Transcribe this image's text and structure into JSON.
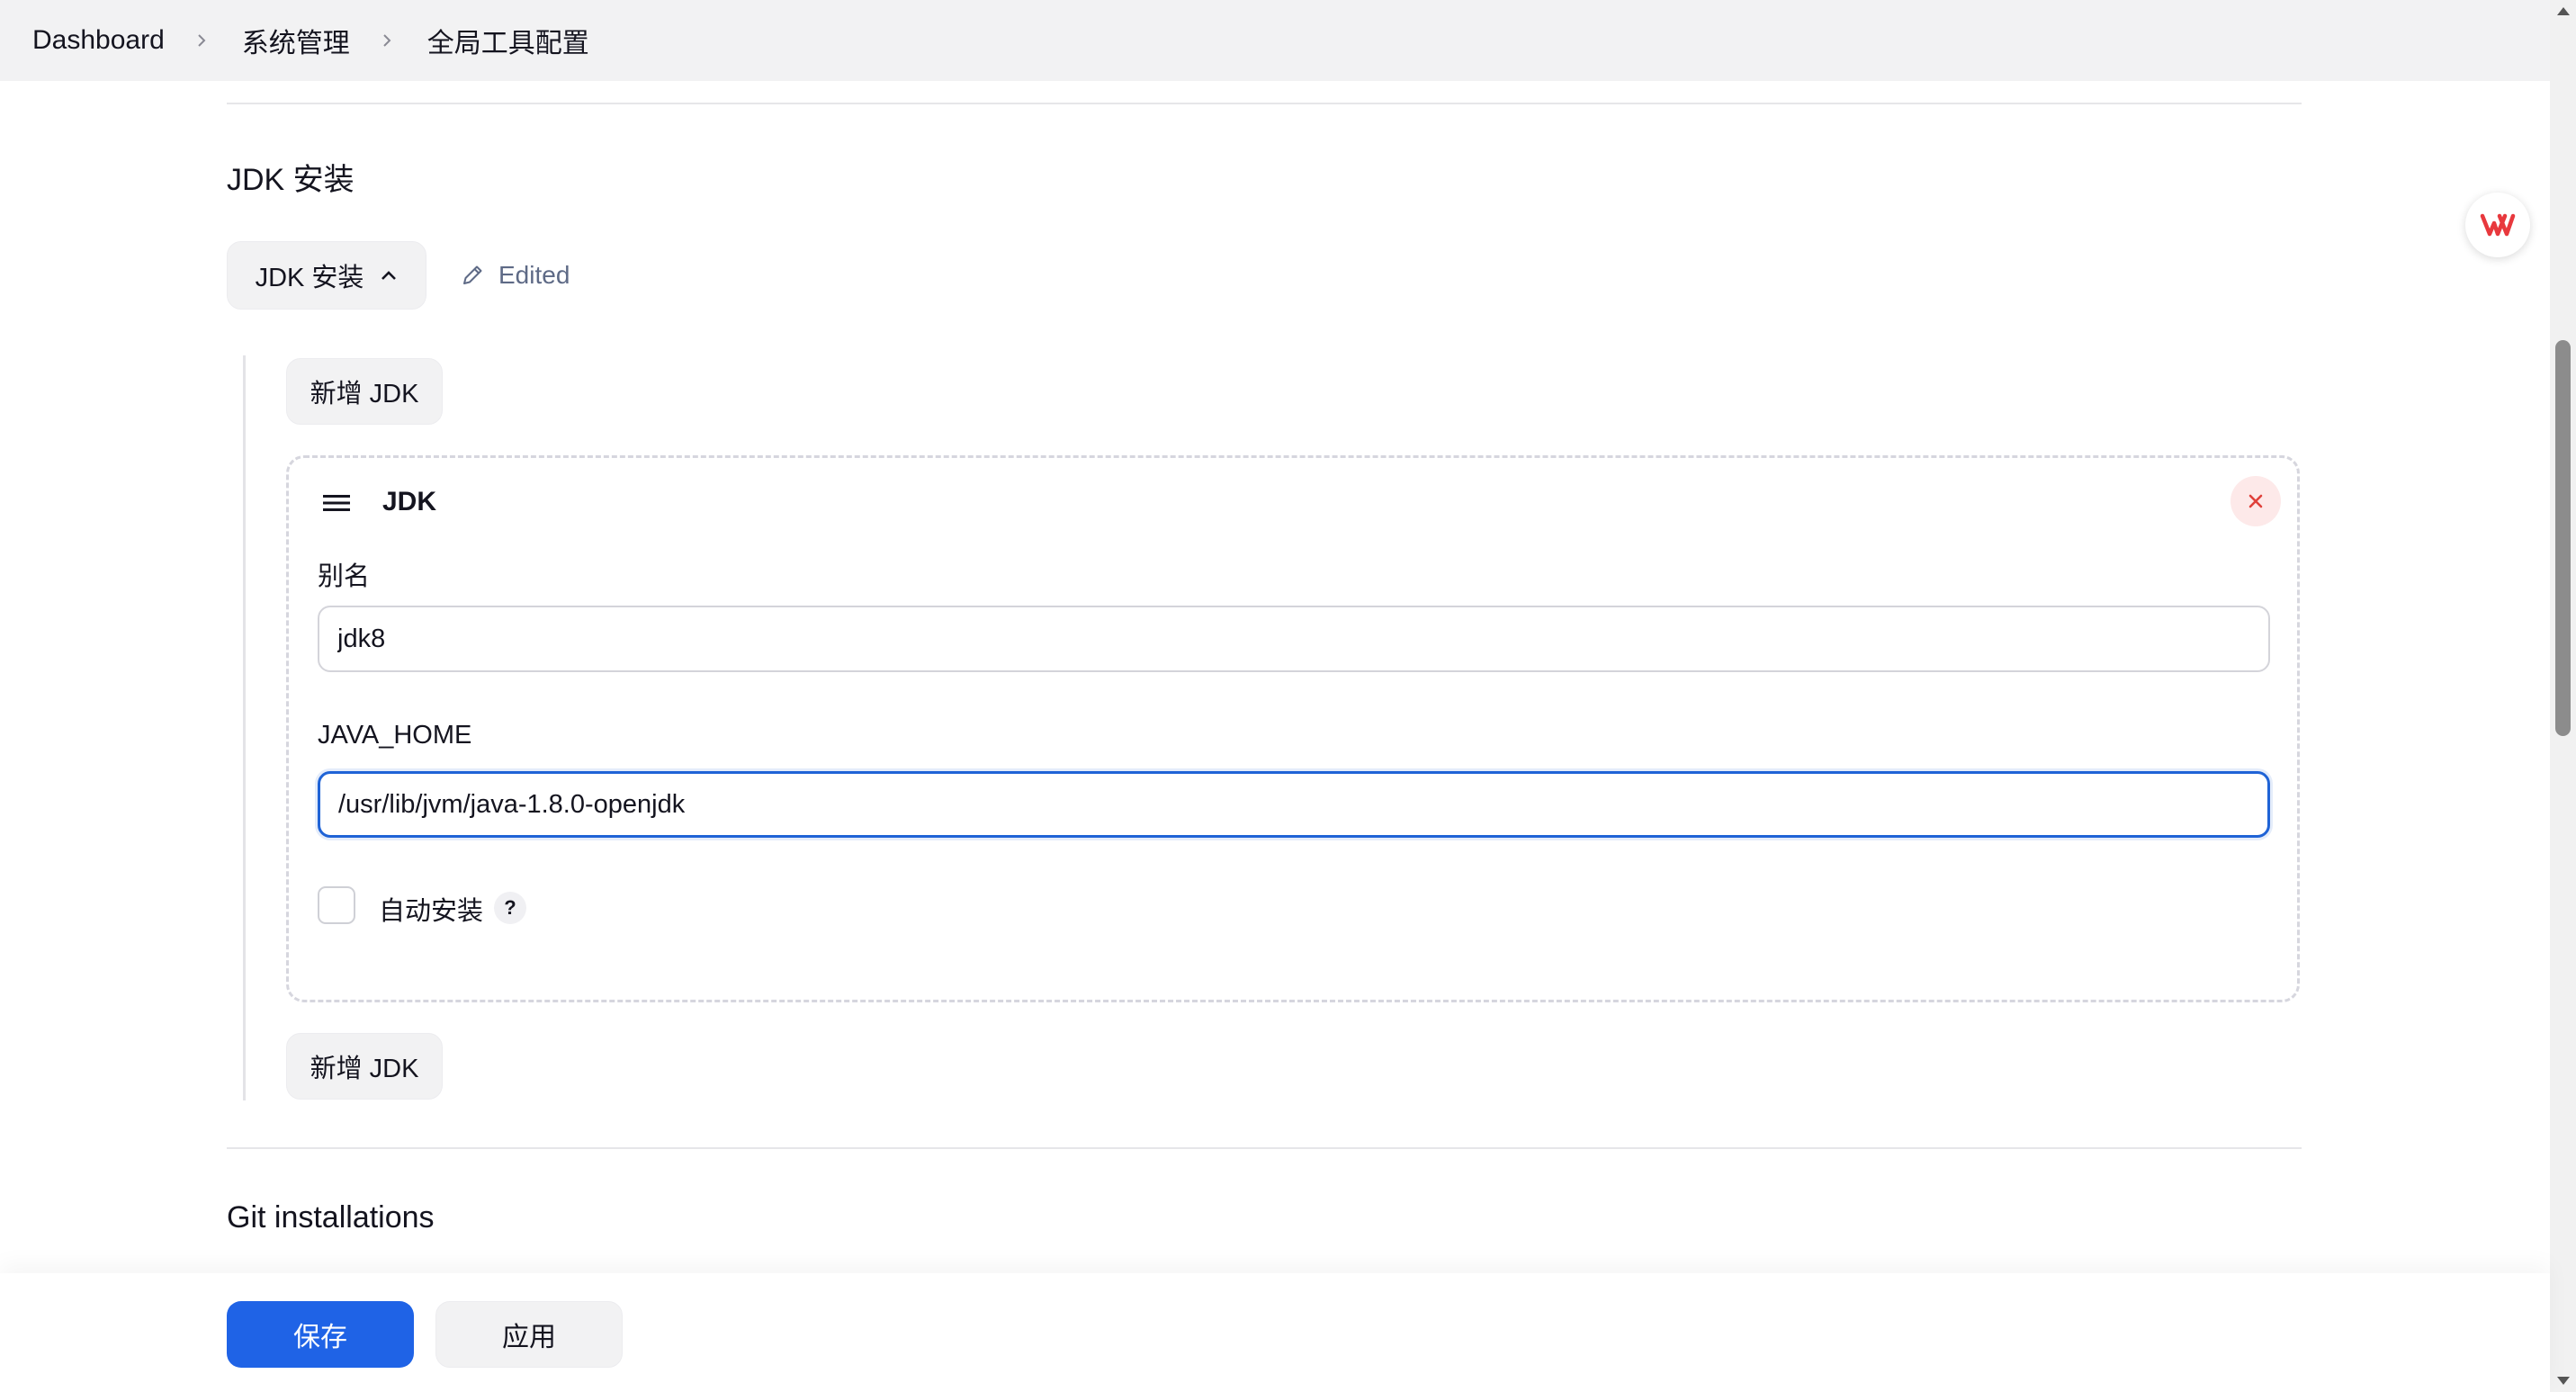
{
  "breadcrumb": {
    "items": [
      "Dashboard",
      "系统管理",
      "全局工具配置"
    ]
  },
  "jdk_section": {
    "title": "JDK 安装",
    "toggle_label": "JDK 安装",
    "edited_label": "Edited",
    "add_button_label": "新增 JDK",
    "card": {
      "title": "JDK",
      "alias_label": "别名",
      "alias_value": "jdk8",
      "java_home_label": "JAVA_HOME",
      "java_home_value": "/usr/lib/jvm/java-1.8.0-openjdk",
      "auto_install_label": "自动安装",
      "help_glyph": "?",
      "auto_install_checked": false
    }
  },
  "git_section": {
    "title": "Git installations"
  },
  "footer": {
    "save_label": "保存",
    "apply_label": "应用"
  },
  "colors": {
    "primary": "#1f63e6",
    "focus_border": "#1f63d6",
    "close_icon": "#e0403a",
    "wps_logo": "#e8383d"
  },
  "icons": {
    "breadcrumb_separator": "chevron-right-icon",
    "toggle": "chevron-up-icon",
    "edited": "pencil-icon",
    "drag_handle": "hamburger-icon",
    "close": "close-icon",
    "floating": "wps-logo-icon"
  }
}
